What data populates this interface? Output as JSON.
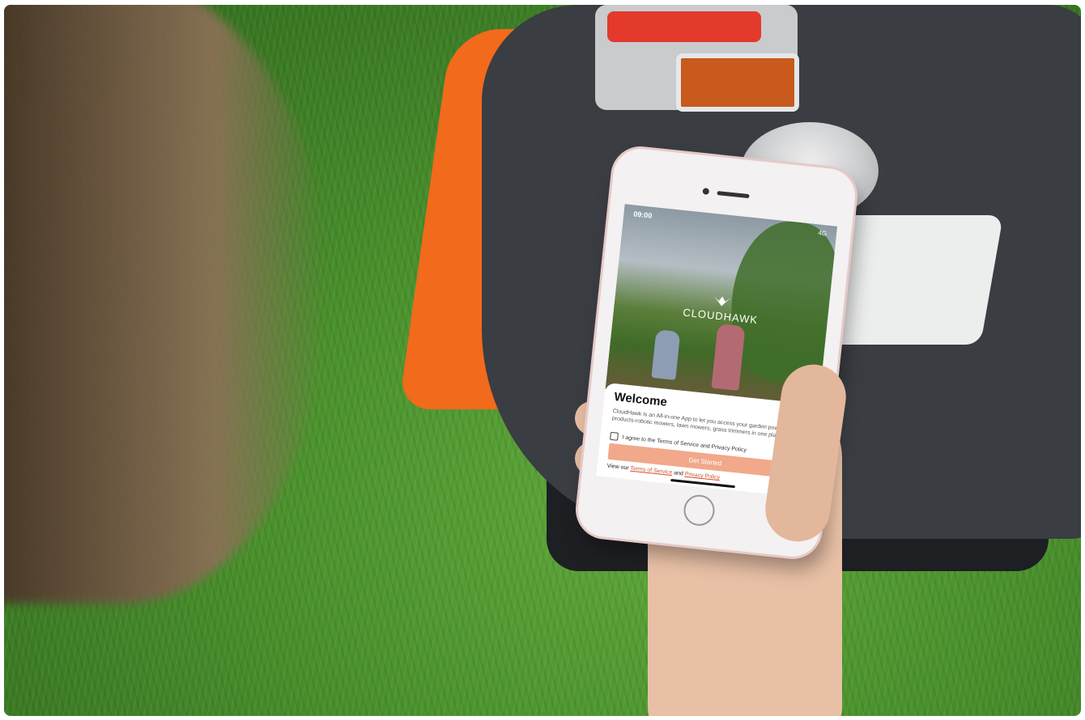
{
  "phone": {
    "status_time": "09:00",
    "status_signal": "4G",
    "app_logo": "CLOUDHAWK",
    "welcome_title": "Welcome",
    "welcome_description": "CloudHawk is an All-in-one App to let you access your garden power products-robotic mowers, lawn mowers, grass trimmers in one place.",
    "terms_checkbox_label": "I agree to the Terms of Service and Privacy Policy",
    "get_started_label": "Get Started",
    "footer_prefix": "View our",
    "terms_link": "Terms of Service",
    "footer_and": "and",
    "privacy_link": "Privacy Policy"
  },
  "colors": {
    "accent": "#f1a88b",
    "mower_orange": "#f26a1b",
    "mower_gray": "#3a3d42",
    "grass": "#4a922c"
  },
  "icons": [
    "cloudhawk-logo-icon",
    "checkbox-icon",
    "home-button-icon"
  ]
}
